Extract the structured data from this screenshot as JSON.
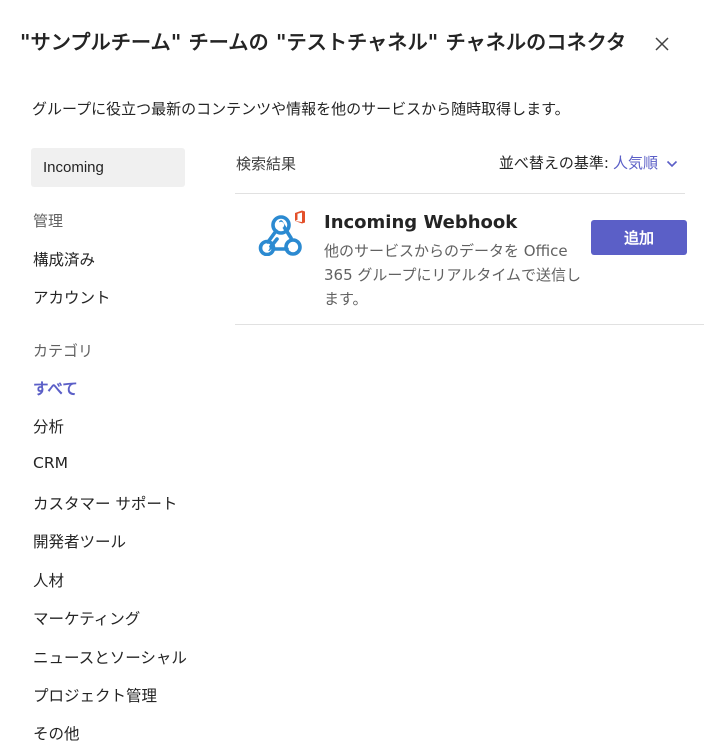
{
  "dialog": {
    "title": "\"サンプルチーム\" チームの \"テストチャネル\" チャネルのコネクタ",
    "close_icon": "close-icon",
    "description": "グループに役立つ最新のコンテンツや情報を他のサービスから随時取得します。"
  },
  "search": {
    "value": "Incoming",
    "placeholder": ""
  },
  "sidebar": {
    "manage_header": "管理",
    "manage_items": [
      {
        "label": "構成済み"
      },
      {
        "label": "アカウント"
      }
    ],
    "category_header": "カテゴリ",
    "category_items": [
      {
        "label": "すべて",
        "selected": true
      },
      {
        "label": "分析"
      },
      {
        "label": "CRM"
      },
      {
        "label": "カスタマー サポート"
      },
      {
        "label": "開発者ツール"
      },
      {
        "label": "人材"
      },
      {
        "label": "マーケティング"
      },
      {
        "label": "ニュースとソーシャル"
      },
      {
        "label": "プロジェクト管理"
      },
      {
        "label": "その他"
      }
    ]
  },
  "results": {
    "label": "検索結果",
    "sort_label": "並べ替えの基準:",
    "sort_value": "人気順",
    "sort_icon": "chevron-down-icon",
    "items": [
      {
        "name": "Incoming Webhook",
        "description": "他のサービスからのデータを Office 365 グループにリアルタイムで送信します。",
        "icon": "webhook-icon",
        "badge_icon": "office-icon",
        "add_label": "追加"
      }
    ]
  },
  "colors": {
    "accent": "#5b5fc7",
    "icon_blue": "#2b8ad1",
    "office_red": "#e3502a",
    "search_bg": "#f0f0f0"
  }
}
